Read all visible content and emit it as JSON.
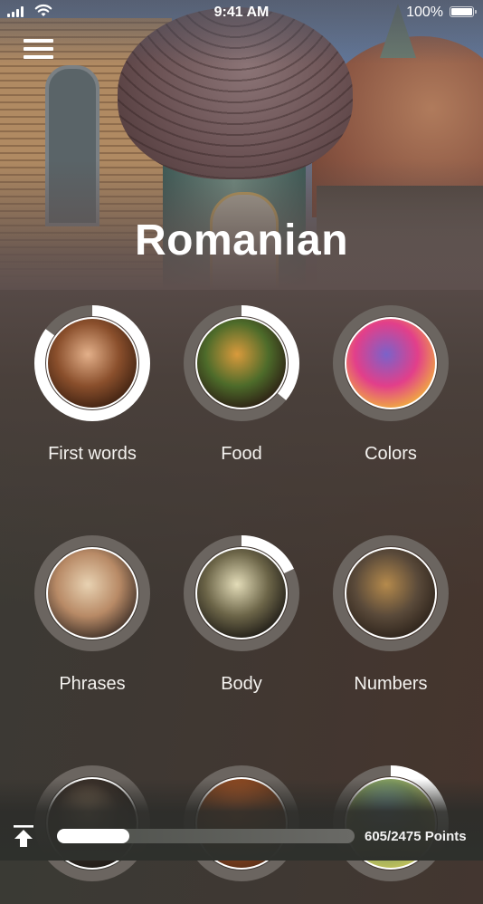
{
  "status_bar": {
    "time": "9:41 AM",
    "battery_text": "100%",
    "battery_level": 1.0
  },
  "header": {
    "menu_icon": "hamburger-menu-icon",
    "title": "Romanian",
    "hero_image": "onion-dome-church-photo"
  },
  "topics": [
    {
      "label": "First words",
      "image": "smiling-child-photo",
      "progress": 0.85
    },
    {
      "label": "Food",
      "image": "burger-and-soda-photo",
      "progress": 0.36
    },
    {
      "label": "Colors",
      "image": "colored-powder-photo",
      "progress": 0
    },
    {
      "label": "Phrases",
      "image": "smiling-woman-photo",
      "progress": 0
    },
    {
      "label": "Body",
      "image": "skeleton-photo",
      "progress": 0.18
    },
    {
      "label": "Numbers",
      "image": "wooden-numbers-photo",
      "progress": 0
    },
    {
      "label": "",
      "image": "headphones-photo",
      "progress": 0
    },
    {
      "label": "",
      "image": "orange-scene-photo",
      "progress": 0
    },
    {
      "label": "",
      "image": "map-with-pins-photo",
      "progress": 0.3
    }
  ],
  "footer": {
    "upload_icon": "upload-icon",
    "points_earned": 605,
    "points_total": 2475,
    "points_text": "605/2475 Points"
  },
  "colors": {
    "ring_track": "#6b6560",
    "ring_progress": "#ffffff",
    "text": "#ffffff"
  }
}
